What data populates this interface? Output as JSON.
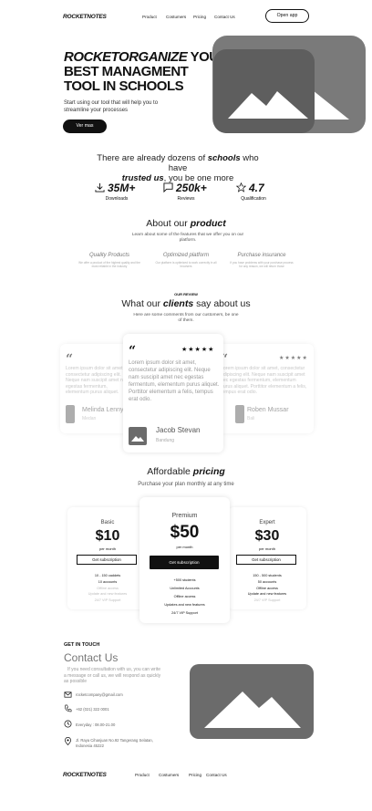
{
  "nav": {
    "logo": "ROCKETNOTES",
    "links": [
      "Product",
      "Costumers",
      "Pricing",
      "Contact Us"
    ],
    "cta": "Open app"
  },
  "hero": {
    "title_em": "ROCKETORGANIZE",
    "title_rest1": " YOUR",
    "title_line2": "BEST MANAGMENT",
    "title_line3": "TOOL IN SCHOOLS",
    "subtitle": "Start using our tool that will help you to streamline your processes",
    "button": "Ver mas"
  },
  "stats": {
    "title_pre": "There are already dozens of ",
    "title_b1": "schools",
    "title_mid": " who have ",
    "title_b2": "trusted us",
    "title_post": ", you be one more",
    "items": [
      {
        "icon": "download-icon",
        "value": "35M+",
        "label": "Downloads"
      },
      {
        "icon": "chat-bubble-icon",
        "value": "250k+",
        "label": "Reviews"
      },
      {
        "icon": "star-icon",
        "value": "4.7",
        "label": "Qualification"
      }
    ]
  },
  "about": {
    "title_pre": "About our ",
    "title_b": "product",
    "subtitle": "Learn about some of the features that we offer you on our platform.",
    "features": [
      {
        "title": "Quality Products",
        "text": "We offer a product of the highest quality and the most reliable in the industry"
      },
      {
        "title": "Optimized platform",
        "text": "Our platform is optimized to work correctly in all browsers"
      },
      {
        "title": "Purchase insurance",
        "text": "If you have problems with your purchase process for any reason, we will return those"
      }
    ]
  },
  "reviews": {
    "kicker": "OUR REVIEW",
    "title_pre": "What our ",
    "title_b": "clients",
    "title_post": " say about us",
    "subtitle": "Here are some comments from our customers, be one of them.",
    "cards": [
      {
        "text": "Lorem ipsum dolor sit amet, consectetur adipiscing elit. Neque nam suscipit amet nec egestas fermentum, elementum purus aliquet. Porttitor elementum a felis, tempus erat odio.",
        "name": "Melinda Lenny",
        "city": "Medan",
        "stars": "★★★★★"
      },
      {
        "text": "Lorem ipsum dolor sit amet, consectetur adipiscing elit. Neque nam suscipit amet nec egestas fermentum, elementum purus aliquet. Porttitor elementum a felis, tempus erat odio.",
        "name": "Jacob Stevan",
        "city": "Bandung",
        "stars": "★★★★★"
      },
      {
        "text": "Lorem ipsum dolor sit amet, consectetur adipiscing elit. Neque nam suscipit amet nec egestas fermentum, elementum purus aliquet. Porttitor elementum a felis, tempus erat odio.",
        "name": "Roben Mussar",
        "city": "Bali",
        "stars": "★★★★★"
      }
    ]
  },
  "pricing": {
    "title_pre": "Affordable ",
    "title_b": "pricing",
    "subtitle": "Purchase your plan monthly at any time",
    "button": "Get subscription",
    "per": "per month",
    "plans": [
      {
        "name": "Basic",
        "price": "$10",
        "features": [
          "10 - 150 caddets",
          "10 accounts",
          "Offline access",
          "Update and new features",
          "24/7 VIP Support"
        ]
      },
      {
        "name": "Premium",
        "price": "$50",
        "features": [
          "+500 students",
          "Unlimited Accounts",
          "Offline access",
          "Updates and new features",
          "24/7 VIP Support"
        ]
      },
      {
        "name": "Expert",
        "price": "$30",
        "features": [
          "150 - 500 students",
          "50 accounts",
          "Offline access",
          "Update and new features",
          "24/7 VIP Support"
        ]
      }
    ]
  },
  "contact": {
    "kicker": "GET IN TOUCH",
    "title": "Contact Us",
    "text": "If you need consultation with us, you can write a message or call us, we will respond as quickly as possible",
    "email": "rocketcompany@gmail.com",
    "phone": "+62 (021) 322 0001",
    "hours": "Everyday : 08.00-21.00",
    "address": "Jl. Raya Cihanjuan No.92 Tangerang Selatan, Indonesia 45222"
  },
  "footer": {
    "logo": "ROCKETNOTES",
    "links": [
      "Product",
      "Costumers",
      "Pricing",
      "Contact Us"
    ]
  }
}
